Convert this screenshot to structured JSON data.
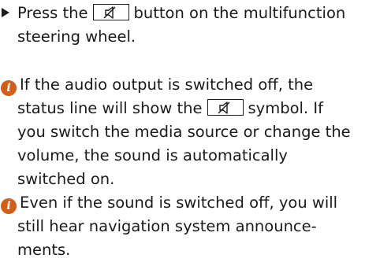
{
  "step": {
    "text_before": "Press the",
    "text_after": "button on the multifunction",
    "line2": "steering wheel."
  },
  "note1": {
    "line1": "If the audio output is switched off, the",
    "line2_before": "status line will show the",
    "line2_after": "symbol. If",
    "line3": "you switch the media source or change the",
    "line4": "volume, the sound is automatically",
    "line5": "switched on."
  },
  "note2": {
    "line1": "Even if the sound is switched off, you will",
    "line2": "still hear navigation system announce-",
    "line3": "ments."
  },
  "icons": {
    "step_marker": "triangle-arrow",
    "info": "info-circle",
    "mute_key": "mute-speaker-symbol",
    "info_color": "#cf5f1a"
  }
}
